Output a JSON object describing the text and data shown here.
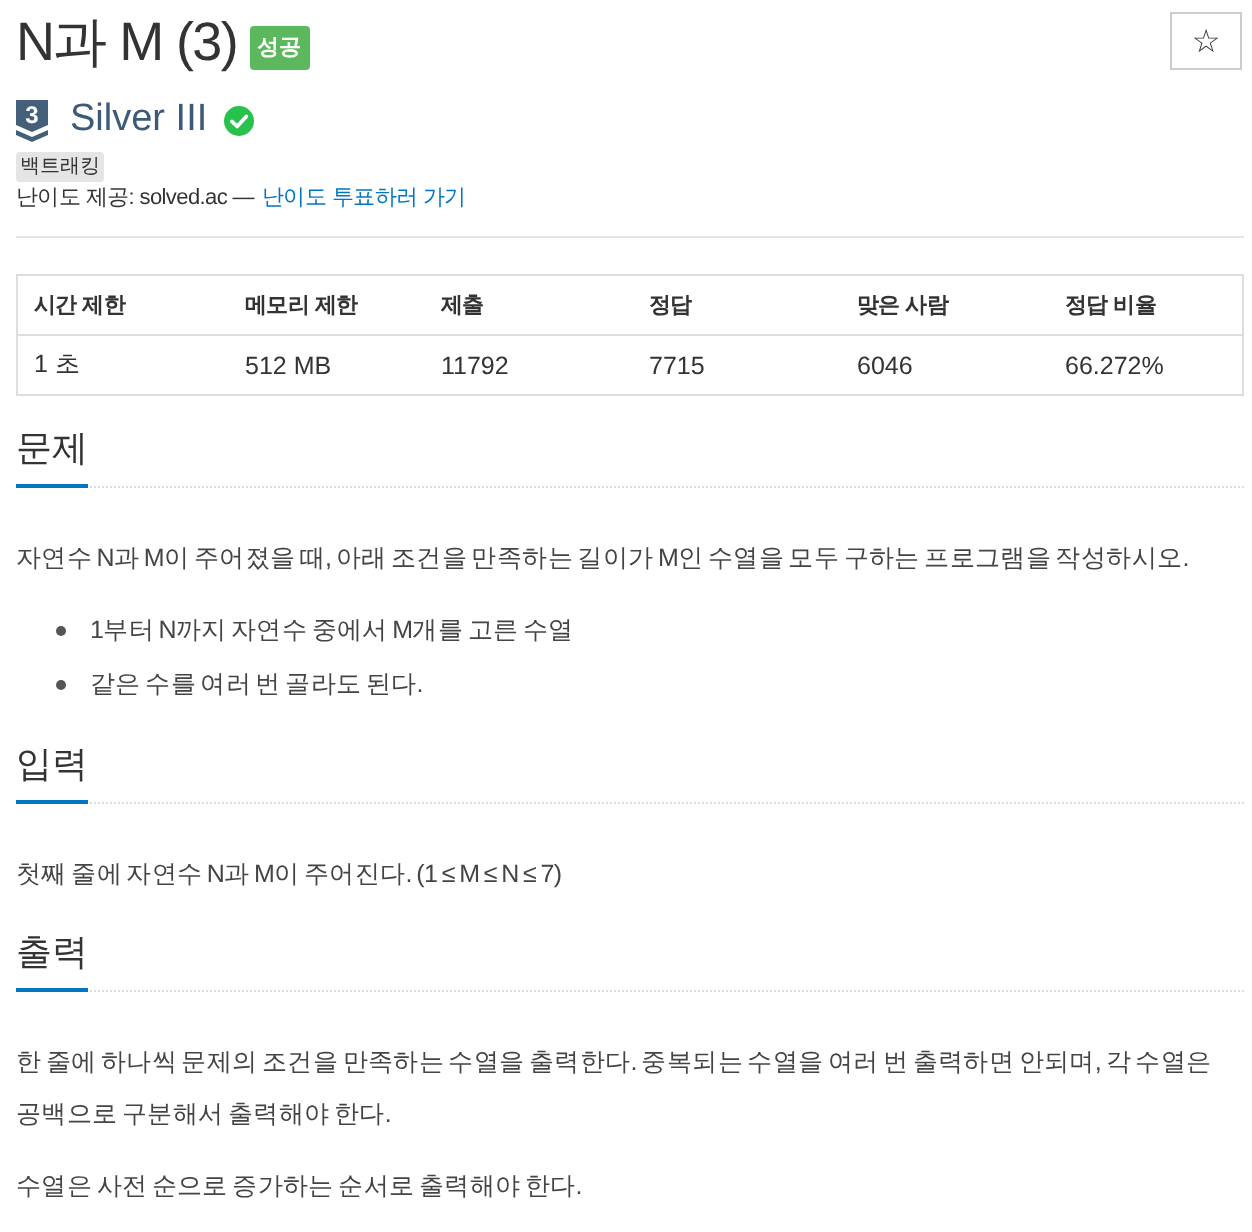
{
  "title": {
    "text": "N과 M (3)",
    "result_badge": {
      "label": "성공",
      "kind": "success"
    }
  },
  "favorite_button": {
    "label": "☆"
  },
  "tier": {
    "rank_number": "3",
    "name": "Silver III",
    "solved": true
  },
  "tags": [
    "백트래킹"
  ],
  "difficulty_credit": {
    "text": "난이도 제공: solved.ac —",
    "link": "난이도 투표하러 가기"
  },
  "info_table": {
    "columns": [
      "시간 제한",
      "메모리 제한",
      "제출",
      "정답",
      "맞은 사람",
      "정답 비율"
    ],
    "rows": [
      [
        "1 초",
        "512 MB",
        "11792",
        "7715",
        "6046",
        "66.272%"
      ]
    ]
  },
  "sections": [
    {
      "heading": "문제",
      "blocks": [
        {
          "kind": "paragraph",
          "text": "자연수 N과 M이 주어졌을 때, 아래 조건을 만족하는 길이가 M인 수열을 모두 구하는 프로그램을 작성하시오."
        },
        {
          "kind": "list",
          "items": [
            "1부터 N까지 자연수 중에서 M개를 고른 수열",
            "같은 수를 여러 번 골라도 된다."
          ]
        }
      ]
    },
    {
      "heading": "입력",
      "blocks": [
        {
          "kind": "paragraph",
          "text": "첫째 줄에 자연수 N과 M이 주어진다. (1 ≤ M ≤ N ≤ 7)"
        }
      ]
    },
    {
      "heading": "출력",
      "blocks": [
        {
          "kind": "paragraph",
          "text": "한 줄에 하나씩 문제의 조건을 만족하는 수열을 출력한다. 중복되는 수열을 여러 번 출력하면 안되며, 각 수열은 공백으로 구분해서 출력해야 한다."
        },
        {
          "kind": "paragraph",
          "text": "수열은 사전 순으로 증가하는 순서로 출력해야 한다."
        }
      ]
    }
  ]
}
